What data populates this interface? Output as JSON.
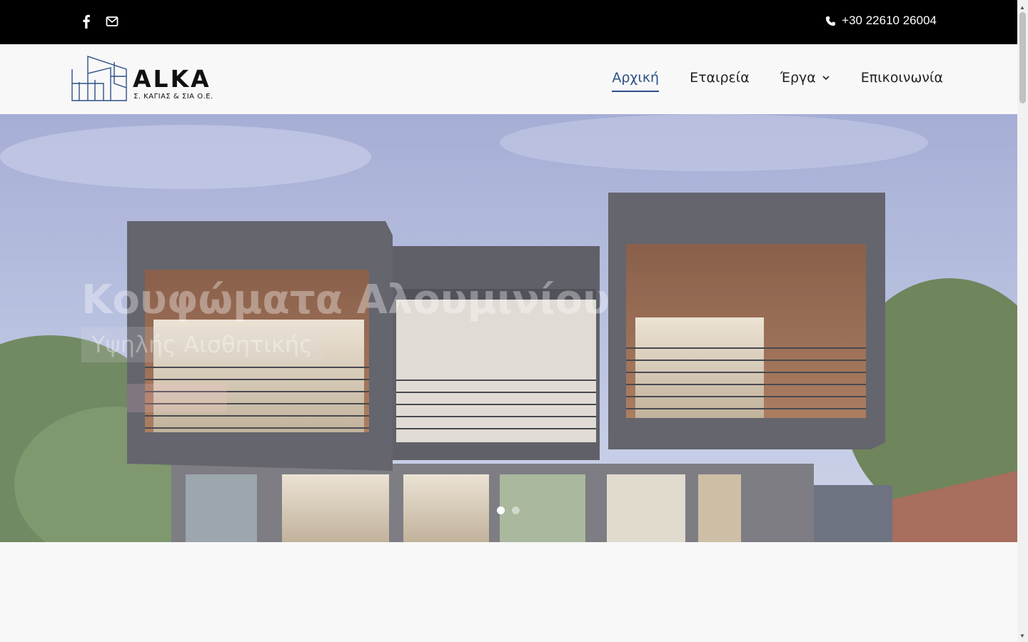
{
  "topbar": {
    "social": [
      {
        "icon": "facebook-icon"
      },
      {
        "icon": "mail-icon"
      }
    ],
    "phone_icon": "phone-icon",
    "phone": "+30 22610 26004"
  },
  "header": {
    "logo": {
      "brand": "ALKA",
      "subtitle": "Σ. ΚΑΓΙΑΣ & ΣΙΑ Ο.Ε."
    },
    "nav": {
      "home": "Αρχική",
      "company": "Εταιρεία",
      "projects": "Έργα",
      "contact": "Επικοινωνία"
    }
  },
  "hero": {
    "title": "Κουφώματα Αλουμινίου",
    "subtitle": "Υψηλής Αισθητικής",
    "slides_total": 2,
    "active_slide": 1
  },
  "colors": {
    "accent": "#2e4f86",
    "topbar": "#000000",
    "header_bg": "#f8f8f8"
  }
}
